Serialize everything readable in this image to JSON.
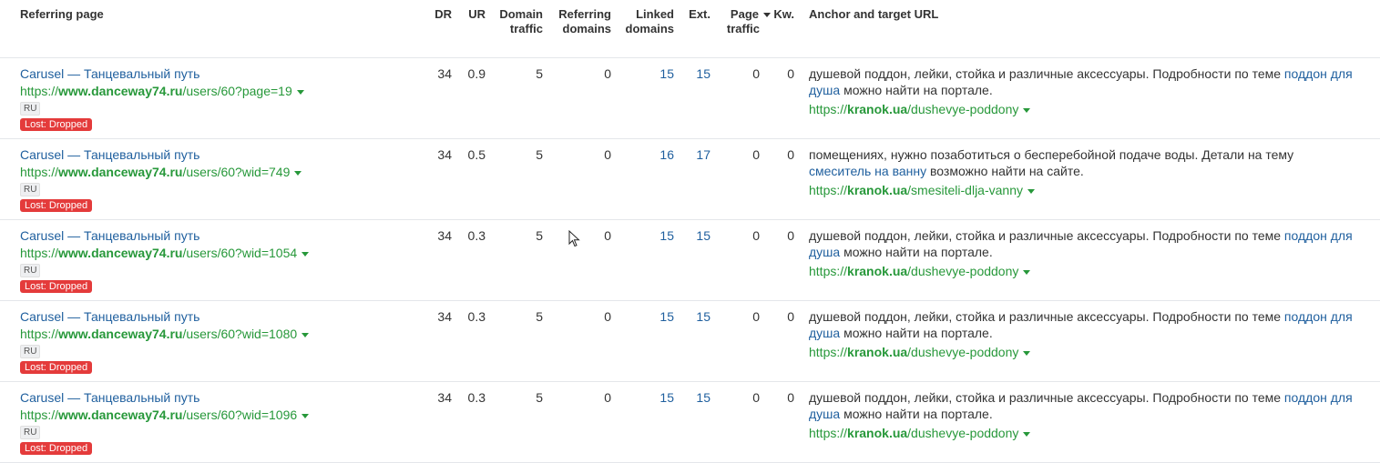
{
  "headers": {
    "referring_page": "Referring page",
    "dr": "DR",
    "ur": "UR",
    "domain_traffic_1": "Domain",
    "domain_traffic_2": "traffic",
    "referring_domains_1": "Referring",
    "referring_domains_2": "domains",
    "linked_domains_1": "Linked",
    "linked_domains_2": "domains",
    "ext": "Ext.",
    "page_traffic_1": "Page",
    "page_traffic_2": "traffic",
    "kw": "Kw.",
    "anchor": "Anchor and target URL"
  },
  "rows": [
    {
      "title": "Carusel — Танцевальный путь",
      "url_prefix": "https://",
      "url_domain": "www.danceway74.ru",
      "url_path": "/users/60?page=19",
      "lang": "RU",
      "status": "Lost: Dropped",
      "dr": "34",
      "ur": "0.9",
      "domain_traffic": "5",
      "referring_domains": "0",
      "linked_domains": "15",
      "ext": "15",
      "page_traffic": "0",
      "kw": "0",
      "anchor_before": "душевой поддон, лейки, стойка и различные аксессуары. Подробности по теме ",
      "anchor_link": "поддон для душа",
      "anchor_after": " можно найти на портале.",
      "target_prefix": "https://",
      "target_domain": "kranok.ua",
      "target_path": "/dushevye-poddony"
    },
    {
      "title": "Carusel — Танцевальный путь",
      "url_prefix": "https://",
      "url_domain": "www.danceway74.ru",
      "url_path": "/users/60?wid=749",
      "lang": "RU",
      "status": "Lost: Dropped",
      "dr": "34",
      "ur": "0.5",
      "domain_traffic": "5",
      "referring_domains": "0",
      "linked_domains": "16",
      "ext": "17",
      "page_traffic": "0",
      "kw": "0",
      "anchor_before": "помещениях, нужно позаботиться о бесперебойной подаче воды. Детали на тему ",
      "anchor_link": "смеситель на ванну",
      "anchor_after": " возможно найти на сайте.",
      "target_prefix": "https://",
      "target_domain": "kranok.ua",
      "target_path": "/smesiteli-dlja-vanny"
    },
    {
      "title": "Carusel — Танцевальный путь",
      "url_prefix": "https://",
      "url_domain": "www.danceway74.ru",
      "url_path": "/users/60?wid=1054",
      "lang": "RU",
      "status": "Lost: Dropped",
      "dr": "34",
      "ur": "0.3",
      "domain_traffic": "5",
      "referring_domains": "0",
      "linked_domains": "15",
      "ext": "15",
      "page_traffic": "0",
      "kw": "0",
      "anchor_before": "душевой поддон, лейки, стойка и различные аксессуары. Подробности по теме ",
      "anchor_link": "поддон для душа",
      "anchor_after": " можно найти на портале.",
      "target_prefix": "https://",
      "target_domain": "kranok.ua",
      "target_path": "/dushevye-poddony"
    },
    {
      "title": "Carusel — Танцевальный путь",
      "url_prefix": "https://",
      "url_domain": "www.danceway74.ru",
      "url_path": "/users/60?wid=1080",
      "lang": "RU",
      "status": "Lost: Dropped",
      "dr": "34",
      "ur": "0.3",
      "domain_traffic": "5",
      "referring_domains": "0",
      "linked_domains": "15",
      "ext": "15",
      "page_traffic": "0",
      "kw": "0",
      "anchor_before": "душевой поддон, лейки, стойка и различные аксессуары. Подробности по теме ",
      "anchor_link": "поддон для душа",
      "anchor_after": " можно найти на портале.",
      "target_prefix": "https://",
      "target_domain": "kranok.ua",
      "target_path": "/dushevye-poddony"
    },
    {
      "title": "Carusel — Танцевальный путь",
      "url_prefix": "https://",
      "url_domain": "www.danceway74.ru",
      "url_path": "/users/60?wid=1096",
      "lang": "RU",
      "status": "Lost: Dropped",
      "dr": "34",
      "ur": "0.3",
      "domain_traffic": "5",
      "referring_domains": "0",
      "linked_domains": "15",
      "ext": "15",
      "page_traffic": "0",
      "kw": "0",
      "anchor_before": "душевой поддон, лейки, стойка и различные аксессуары. Подробности по теме ",
      "anchor_link": "поддон для душа",
      "anchor_after": " можно найти на портале.",
      "target_prefix": "https://",
      "target_domain": "kranok.ua",
      "target_path": "/dushevye-poddony"
    }
  ],
  "colors": {
    "link": "#1f5f9e",
    "url_green": "#27983a",
    "lost_badge": "#e43b3b",
    "divider": "#e4e6ea"
  },
  "sort": {
    "column": "page_traffic",
    "direction": "desc",
    "icon": "sort-down-icon"
  }
}
